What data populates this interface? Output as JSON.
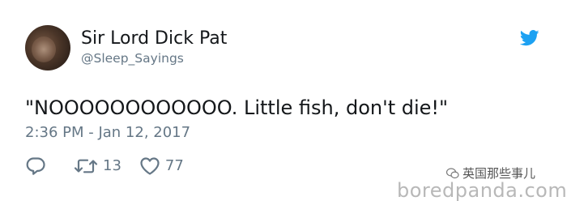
{
  "tweet": {
    "author": {
      "display_name": "Sir Lord Dick Pat",
      "handle": "@Sleep_Sayings"
    },
    "text": "\"NOOOOOOOOOOOO. Little fish, don't die!\"",
    "timestamp": "2:36 PM - Jan 12, 2017",
    "actions": {
      "reply_icon": "reply-icon",
      "retweet_icon": "retweet-icon",
      "retweet_count": "13",
      "like_icon": "heart-icon",
      "like_count": "77"
    },
    "brand_icon": "twitter-bird-icon"
  },
  "watermarks": {
    "source": "boredpanda.com",
    "wechat": "英国那些事儿"
  },
  "colors": {
    "text_primary": "#14171a",
    "text_secondary": "#657786",
    "twitter_blue": "#1da1f2",
    "background": "#ffffff"
  }
}
